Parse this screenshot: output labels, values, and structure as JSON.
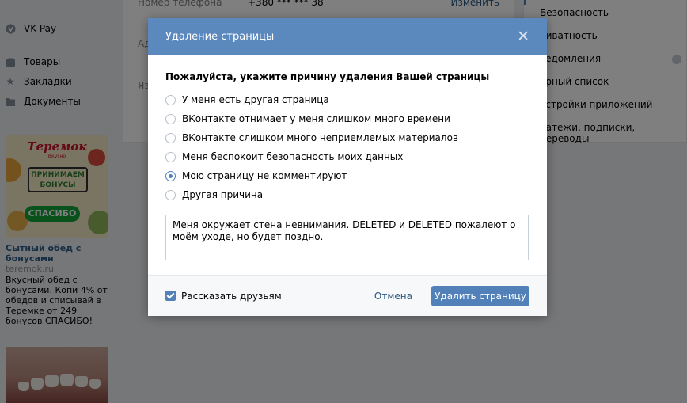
{
  "background": {
    "nav": [
      {
        "label": "VK Pay",
        "icon": "vk-pay-icon"
      },
      {
        "label": "Товары",
        "icon": "goods-icon"
      },
      {
        "label": "Закладки",
        "icon": "star-icon"
      },
      {
        "label": "Документы",
        "icon": "documents-icon"
      }
    ],
    "ad": {
      "brand": "Теремок",
      "brand_sub": "Вкусно",
      "banner": "ПРИНИМАЕМ БОНУСЫ",
      "badge": "СПАСИБО",
      "title": "Сытный обед с бонусами",
      "domain": "teremok.ru",
      "text": "Вкусный обед с бонусами. Копи 4% от обедов и списывай в Теремке от 249 бонусов СПАСИБО!"
    },
    "settings": {
      "phone_label": "Номер телефона",
      "phone_value": "+380 *** *** 38",
      "phone_action": "Изменить",
      "row2_label": "Ад",
      "row3_label": "Яз"
    },
    "right_menu": [
      "Безопасность",
      "риватность",
      "ведомления",
      "ёрный список",
      "астройки приложений",
      "латежи, подписки, переводы"
    ]
  },
  "modal": {
    "title": "Удаление страницы",
    "question": "Пожалуйста, укажите причину удаления Вашей страницы",
    "options": [
      "У меня есть другая страница",
      "ВКонтакте отнимает у меня слишком много времени",
      "ВКонтакте слишком много неприемлемых материалов",
      "Меня беспокоит безопасность моих данных",
      "Мою страницу не комментируют",
      "Другая причина"
    ],
    "selected_option": "Мою страницу не комментируют",
    "reason_text": "Меня окружает стена невнимания. DELETED и DELETED пожалеют о моём уходе, но будет поздно.",
    "tell_friends_label": "Рассказать друзьям",
    "tell_friends_checked": true,
    "cancel_label": "Отмена",
    "delete_label": "Удалить страницу"
  },
  "colors": {
    "header": "#5b88bd",
    "accent": "#5181b8",
    "link": "#2a5885"
  }
}
